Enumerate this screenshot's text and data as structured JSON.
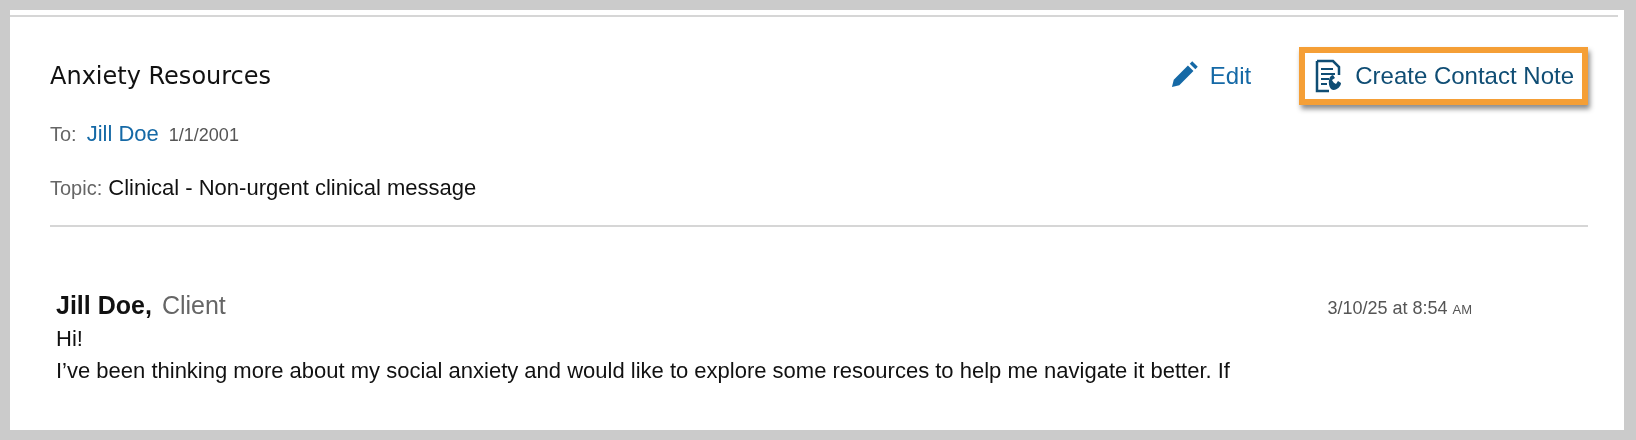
{
  "message": {
    "title": "Anxiety Resources",
    "actions": [
      {
        "kind": "edit",
        "label": "Edit",
        "highlighted": false
      },
      {
        "kind": "contact-note",
        "label": "Create Contact Note",
        "highlighted": true
      }
    ],
    "to": {
      "label": "To:",
      "name": "Jill Doe",
      "date": "1/1/2001"
    },
    "topic": {
      "label": "Topic:",
      "value": "Clinical - Non-urgent clinical message"
    }
  },
  "entry": {
    "author": "Jill Doe,",
    "role": "Client",
    "time": "3/10/25 at 8:54",
    "meridiem": "AM",
    "lines": [
      "Hi!",
      "I’ve been thinking more about my social anxiety and would like to explore some resources to help me navigate it better. If"
    ]
  }
}
